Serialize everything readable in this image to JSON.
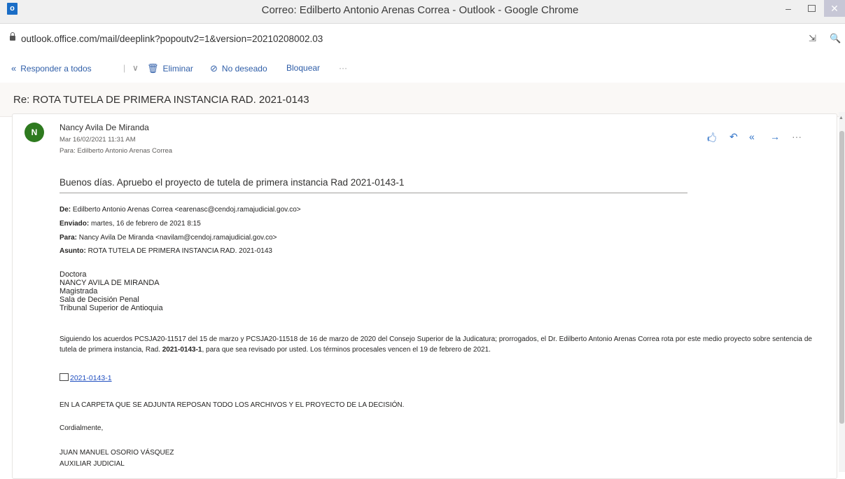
{
  "window": {
    "app_icon_letter": "o",
    "title": "Correo: Edilberto Antonio Arenas Correa - Outlook - Google Chrome",
    "minimize": "–",
    "close": "✕"
  },
  "browser": {
    "url": "outlook.office.com/mail/deeplink?popoutv2=1&version=20210208002.03",
    "install_icon": "⇲",
    "zoom_icon": "🔍"
  },
  "toolbar": {
    "reply_all_icon": "«",
    "reply_all": "Responder a todos",
    "separator": "|",
    "chevron": "∨",
    "delete_icon": "🗑",
    "delete": "Eliminar",
    "junk_icon": "⊘",
    "junk": "No deseado",
    "block": "Bloquear",
    "more": "···"
  },
  "email": {
    "subject": "Re: ROTA TUTELA DE PRIMERA INSTANCIA RAD. 2021-0143",
    "avatar_initial": "N",
    "sender": "Nancy Avila De Miranda",
    "date": "Mar 16/02/2021 11:31 AM",
    "to_label": "Para:",
    "to": "Edilberto Antonio Arenas Correa",
    "actions": {
      "like": "🖒",
      "reply": "↶",
      "reply_all": "«",
      "forward": "→",
      "more": "···"
    },
    "greeting": "Buenos días. Apruebo el proyecto de tutela de primera instancia Rad 2021-0143-1",
    "quoted": {
      "from_label": "De:",
      "from": "Edilberto Antonio Arenas Correa <earenasc@cendoj.ramajudicial.gov.co>",
      "sent_label": "Enviado:",
      "sent": "martes, 16 de febrero de 2021 8:15",
      "to_label": "Para:",
      "to": "Nancy Avila De Miranda <navilam@cendoj.ramajudicial.gov.co>",
      "subject_label": "Asunto:",
      "subject": "ROTA TUTELA DE PRIMERA INSTANCIA RAD. 2021-0143"
    },
    "recipient_block": [
      "Doctora",
      "NANCY AVILA DE MIRANDA",
      "Magistrada",
      "Sala de Decisión Penal",
      "Tribunal Superior de Antioquia"
    ],
    "body_part1": "Siguiendo los acuerdos PCSJA20-11517 del 15 de marzo y PCSJA20-11518 de 16 de marzo de 2020 del Consejo Superior de la Judicatura; prorrogados, el Dr. Edilberto Antonio Arenas Correa rota por este medio proyecto sobre sentencia de tutela de primera instancia, Rad. ",
    "body_bold": "2021-0143-1",
    "body_part2": ", para que sea revisado por usted. Los términos procesales vencen el 19 de febrero de 2021.",
    "attachment": "2021-0143-1",
    "folder_note": "EN LA CARPETA QUE SE ADJUNTA REPOSAN TODO LOS ARCHIVOS Y EL PROYECTO DE LA DECISIÓN.",
    "closing": "Cordialmente,",
    "signature_name": "JUAN MANUEL OSORIO VÁSQUEZ",
    "signature_title": "AUXILIAR JUDICIAL"
  }
}
